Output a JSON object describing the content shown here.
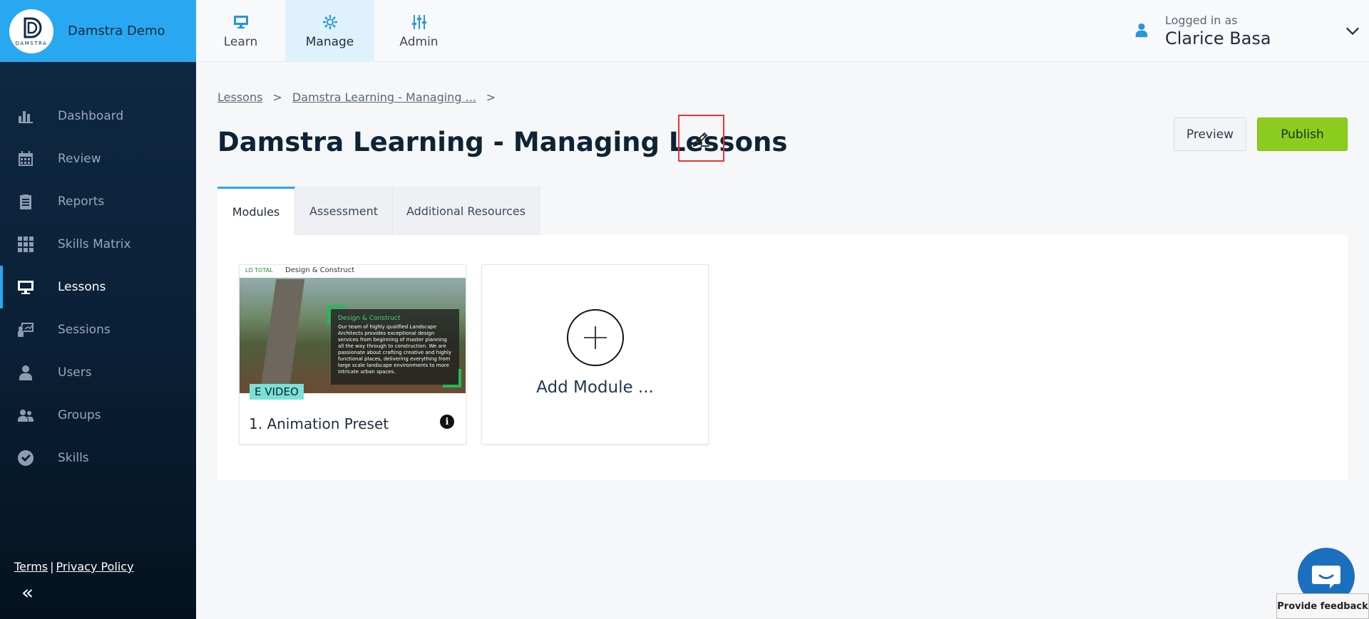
{
  "brand": {
    "name": "Damstra Demo",
    "logo_text": "DAMSTRA"
  },
  "sidebar": {
    "items": [
      {
        "label": "Dashboard",
        "icon": "bar-chart-icon"
      },
      {
        "label": "Review",
        "icon": "calendar-icon"
      },
      {
        "label": "Reports",
        "icon": "clipboard-icon"
      },
      {
        "label": "Skills Matrix",
        "icon": "grid-check-icon"
      },
      {
        "label": "Lessons",
        "icon": "monitor-icon",
        "active": true
      },
      {
        "label": "Sessions",
        "icon": "presentation-icon"
      },
      {
        "label": "Users",
        "icon": "user-icon"
      },
      {
        "label": "Groups",
        "icon": "group-icon"
      },
      {
        "label": "Skills",
        "icon": "check-circle-icon"
      }
    ],
    "footer": {
      "terms": "Terms",
      "separator": "|",
      "privacy": "Privacy Policy"
    },
    "collapse_glyph": "«"
  },
  "topnav": {
    "tabs": [
      {
        "label": "Learn",
        "icon": "monitor-icon"
      },
      {
        "label": "Manage",
        "icon": "gear-icon",
        "active": true
      },
      {
        "label": "Admin",
        "icon": "sliders-icon"
      }
    ]
  },
  "user": {
    "logged_in_label": "Logged in as",
    "name": "Clarice Basa"
  },
  "breadcrumb": {
    "items": [
      "Lessons",
      "Damstra Learning - Managing ..."
    ],
    "separator": ">"
  },
  "page": {
    "title": "Damstra Learning - Managing Lessons",
    "preview_label": "Preview",
    "publish_label": "Publish"
  },
  "tabs": [
    {
      "label": "Modules",
      "active": true
    },
    {
      "label": "Assessment"
    },
    {
      "label": "Additional Resources"
    }
  ],
  "modules": [
    {
      "title": "1. Animation Preset",
      "tag": "E VIDEO",
      "thumb": {
        "brand": "LD TOTAL",
        "header": "Design & Construct",
        "overlay_title": "Design & Construct",
        "overlay_body": "Our team of highly qualified Landscape Architects provides exceptional design services from beginning of master planning all the way through to construction. We are passionate about crafting creative and highly functional places, delivering everything from large scale landscape environments to more intricate urban spaces."
      }
    }
  ],
  "add_module_label": "Add Module ...",
  "feedback_label": "Provide feedback",
  "colors": {
    "accent": "#28a8f0",
    "publish": "#8bcc1e",
    "sidebar": "#0f2a45",
    "highlight": "#e33333"
  }
}
